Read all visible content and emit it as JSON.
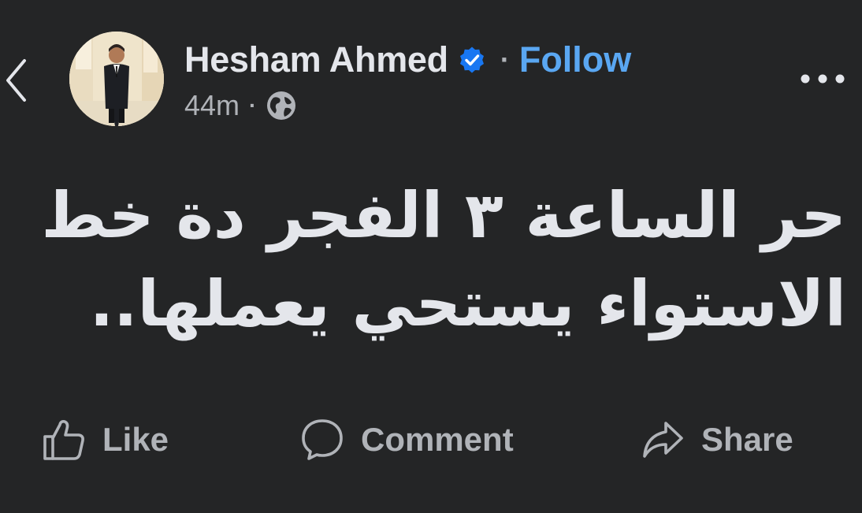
{
  "post": {
    "author": "Hesham Ahmed",
    "follow_label": "Follow",
    "separator": "·",
    "timestamp": "44m",
    "audience_icon": "globe-icon",
    "verified_icon": "verified-badge-icon",
    "text_lines": [
      "حر الساعة ٣ الفجر دة خط",
      "الاستواء يستحي يعملها.."
    ]
  },
  "actions": {
    "like": {
      "label": "Like",
      "icon": "thumbs-up-icon"
    },
    "comment": {
      "label": "Comment",
      "icon": "comment-bubble-icon"
    },
    "share": {
      "label": "Share",
      "icon": "share-arrow-icon"
    }
  },
  "colors": {
    "background": "#242526",
    "primary_text": "#e4e6eb",
    "secondary_text": "#b0b3b8",
    "accent": "#5aa7f2",
    "verified": "#1877f2"
  }
}
